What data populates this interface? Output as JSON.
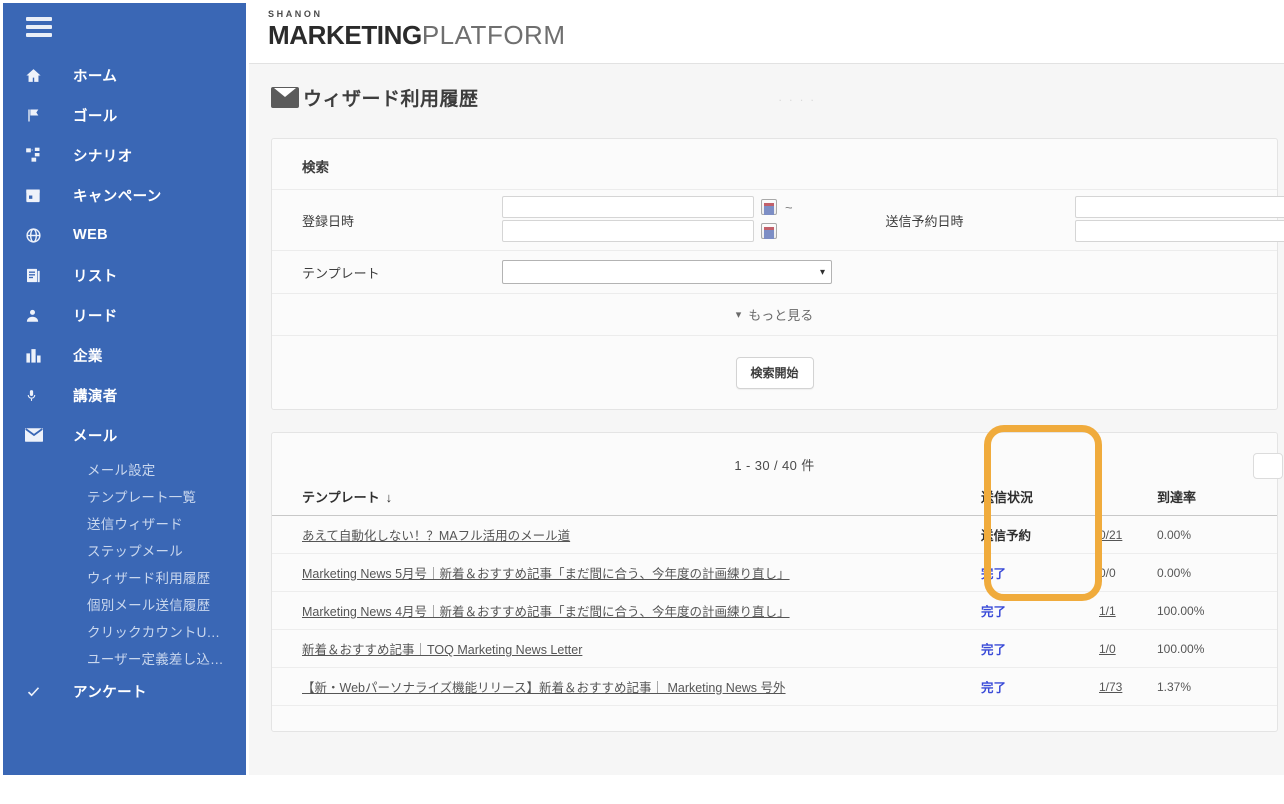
{
  "sidebar": {
    "menu_icon": "hamburger-icon",
    "items": [
      {
        "label": "ホーム",
        "icon": "home-icon"
      },
      {
        "label": "ゴール",
        "icon": "flag-icon"
      },
      {
        "label": "シナリオ",
        "icon": "sitemap-icon"
      },
      {
        "label": "キャンペーン",
        "icon": "calendar-icon"
      },
      {
        "label": "WEB",
        "icon": "globe-icon"
      },
      {
        "label": "リスト",
        "icon": "list-icon"
      },
      {
        "label": "リード",
        "icon": "person-icon"
      },
      {
        "label": "企業",
        "icon": "building-icon"
      },
      {
        "label": "講演者",
        "icon": "microphone-icon"
      },
      {
        "label": "メール",
        "icon": "envelope-icon"
      }
    ],
    "mail_sub_items": [
      "メール設定",
      "テンプレート一覧",
      "送信ウィザード",
      "ステップメール",
      "ウィザード利用履歴",
      "個別メール送信履歴",
      "クリックカウントU…",
      "ユーザー定義差し込…"
    ],
    "last_item": {
      "label": "アンケート",
      "icon": "check-icon"
    },
    "bg_color": "#3a67b5"
  },
  "header": {
    "logo_small": "SHANON",
    "logo_bold": "MARKETING",
    "logo_thin": "PLATFORM"
  },
  "page": {
    "title": "ウィザード利用履歴",
    "title_icon": "envelope-icon"
  },
  "search": {
    "title": "検索",
    "registered_label": "登録日時",
    "registered_from": "",
    "registered_to": "",
    "range_separator": "~",
    "scheduled_label": "送信予約日時",
    "scheduled_from": "",
    "scheduled_to": "",
    "template_label": "テンプレート",
    "template_value": "",
    "calendar_icon": "calendar-picker-icon",
    "chevron_icon": "chevron-down-icon",
    "more_label": "もっと見る",
    "more_icon": "chevron-down-icon",
    "submit_label": "検索開始"
  },
  "results": {
    "count_text": "1 - 30 / 40 件",
    "columns": {
      "template": "テンプレート",
      "sort_indicator": "↓",
      "status": "送信状況",
      "rate": "到達率"
    },
    "rows": [
      {
        "template": "あえて自動化しない！？MAフル活用のメール道",
        "status": "送信予約",
        "status_kind": "scheduled",
        "count": "0/21",
        "count_link": true,
        "rate": "0.00%"
      },
      {
        "template": "Marketing News 5月号｜新着＆おすすめ記事「まだ間に合う、今年度の計画練り直し」",
        "status": "完了",
        "status_kind": "done",
        "count": "0/0",
        "count_link": false,
        "rate": "0.00%"
      },
      {
        "template": "Marketing News 4月号｜新着＆おすすめ記事「まだ間に合う、今年度の計画練り直し」",
        "status": "完了",
        "status_kind": "done",
        "count": "1/1",
        "count_link": true,
        "rate": "100.00%"
      },
      {
        "template": "新着＆おすすめ記事｜TOQ Marketing News Letter",
        "status": "完了",
        "status_kind": "done",
        "count": "1/0",
        "count_link": true,
        "rate": "100.00%"
      },
      {
        "template": "【新・Webパーソナライズ機能リリース】新着＆おすすめ記事｜ Marketing News 号外",
        "status": "完了",
        "status_kind": "done",
        "count": "1/73",
        "count_link": true,
        "rate": "1.37%"
      }
    ]
  },
  "annotation": {
    "color": "#f0ab3c",
    "target": "送信状況"
  }
}
